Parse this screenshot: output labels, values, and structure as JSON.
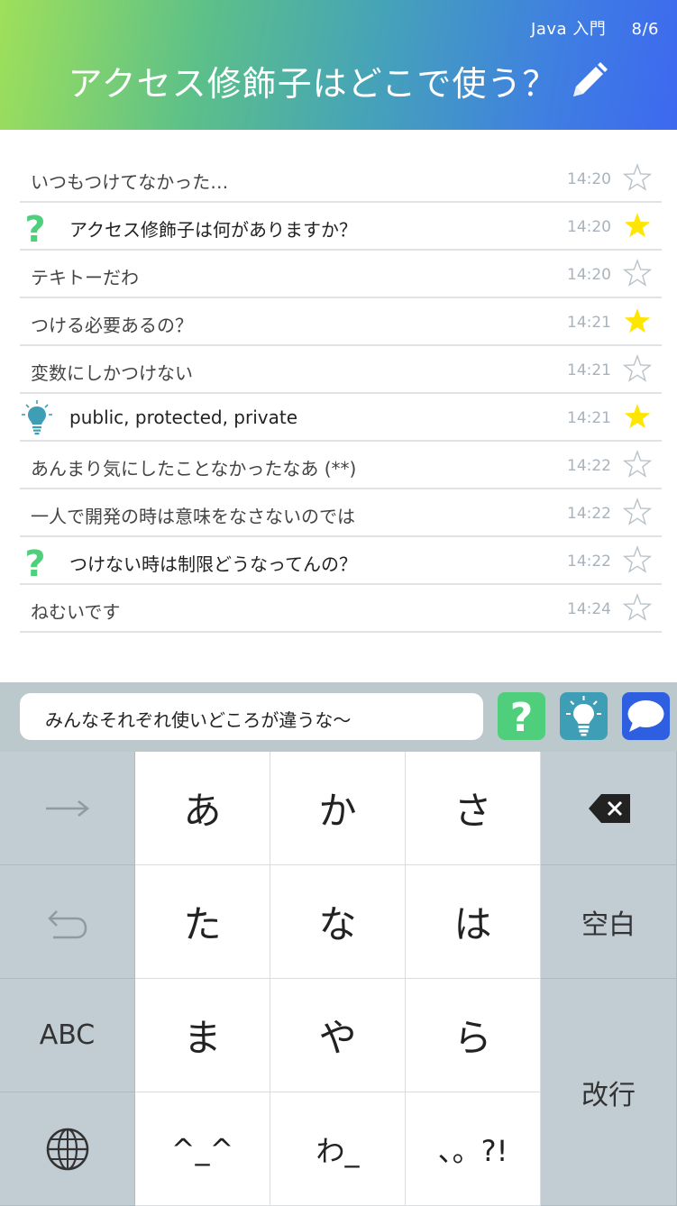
{
  "header": {
    "course": "Java 入門",
    "date": "8/6",
    "title": "アクセス修飾子はどこで使う？",
    "icon": "pencil-icon"
  },
  "messages": [
    {
      "text": "いつもつけてなかった…",
      "time": "14:20",
      "starred": false,
      "tag": null
    },
    {
      "text": "アクセス修飾子は何がありますか？",
      "time": "14:20",
      "starred": true,
      "tag": "question"
    },
    {
      "text": "テキトーだわ",
      "time": "14:20",
      "starred": false,
      "tag": null
    },
    {
      "text": "つける必要あるの？",
      "time": "14:21",
      "starred": true,
      "tag": null
    },
    {
      "text": "変数にしかつけない",
      "time": "14:21",
      "starred": false,
      "tag": null
    },
    {
      "text": "public, protected, private",
      "time": "14:21",
      "starred": true,
      "tag": "idea"
    },
    {
      "text": "あんまり気にしたことなかったなあ (**)",
      "time": "14:22",
      "starred": false,
      "tag": null
    },
    {
      "text": "一人で開発の時は意味をなさないのでは",
      "time": "14:22",
      "starred": false,
      "tag": null
    },
    {
      "text": "つけない時は制限どうなってんの？",
      "time": "14:22",
      "starred": false,
      "tag": "question"
    },
    {
      "text": "ねむいです",
      "time": "14:24",
      "starred": false,
      "tag": null
    }
  ],
  "input": {
    "value": "みんなそれぞれ使いどころが違うな〜",
    "buttons": [
      "question-button",
      "idea-button",
      "chat-button"
    ]
  },
  "colors": {
    "star_on": "#ffe600",
    "question": "#4fcf7c",
    "idea": "#3d9eb6",
    "chat": "#2d5fe0"
  },
  "keyboard": {
    "left": [
      "→",
      "undo",
      "ABC",
      "globe"
    ],
    "keys": [
      [
        "あ",
        "か",
        "さ"
      ],
      [
        "た",
        "な",
        "は"
      ],
      [
        "ま",
        "や",
        "ら"
      ],
      [
        "^_^",
        "わ_",
        "、。?!"
      ]
    ],
    "right": [
      "delete",
      "空白",
      "改行"
    ]
  }
}
